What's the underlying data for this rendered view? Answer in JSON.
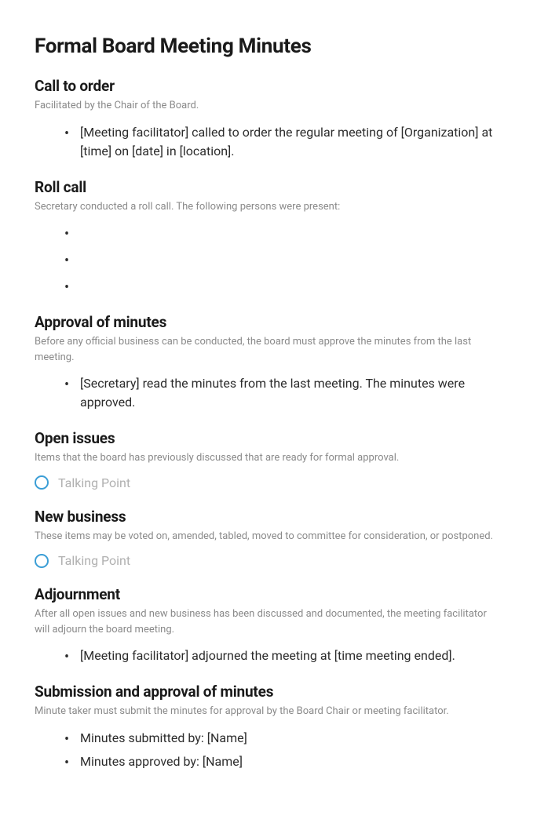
{
  "title": "Formal Board Meeting Minutes",
  "sections": {
    "callToOrder": {
      "heading": "Call to order",
      "description": "Facilitated by the Chair of the Board.",
      "items": [
        "[Meeting facilitator] called to order the regular meeting of [Organization] at [time] on [date] in [location]."
      ]
    },
    "rollCall": {
      "heading": "Roll call",
      "description": "Secretary conducted a roll call. The following persons were present:",
      "items": [
        "",
        "",
        ""
      ]
    },
    "approvalOfMinutes": {
      "heading": "Approval of minutes",
      "description": "Before any official business can be conducted, the board must approve the minutes from the last meeting.",
      "items": [
        "[Secretary] read the minutes from the last meeting. The minutes were approved."
      ]
    },
    "openIssues": {
      "heading": "Open issues",
      "description": "Items that the board has previously discussed that are ready for formal approval.",
      "talkingPoint": "Talking Point"
    },
    "newBusiness": {
      "heading": "New business",
      "description": "These items may be voted on, amended, tabled, moved to committee for consideration, or postponed.",
      "talkingPoint": "Talking Point"
    },
    "adjournment": {
      "heading": "Adjournment",
      "description": "After all open issues and new business has been discussed and documented, the meeting facilitator will adjourn the board meeting.",
      "items": [
        "[Meeting facilitator] adjourned the meeting at [time meeting ended]."
      ]
    },
    "submission": {
      "heading": "Submission and approval of minutes",
      "description": "Minute taker must submit the minutes for approval by the Board Chair or meeting facilitator.",
      "items": [
        "Minutes submitted by: [Name]",
        "Minutes approved by: [Name]"
      ]
    }
  }
}
